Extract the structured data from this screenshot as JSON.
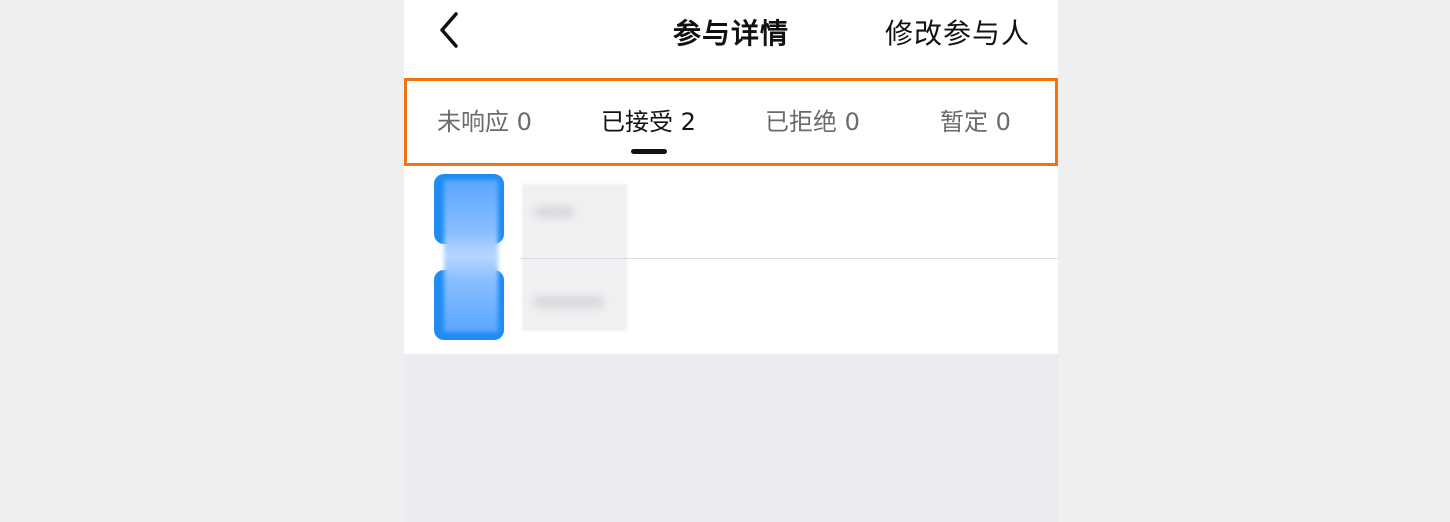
{
  "header": {
    "title": "参与详情",
    "modify_label": "修改参与人"
  },
  "tabs": [
    {
      "label": "未响应 0",
      "active": false
    },
    {
      "label": "已接受 2",
      "active": true
    },
    {
      "label": "已拒绝 0",
      "active": false
    },
    {
      "label": "暂定 0",
      "active": false
    }
  ],
  "icons": {
    "back": "chevron-left-icon"
  },
  "colors": {
    "highlight_border": "#ee7418",
    "avatar": "#1f8cf3",
    "background": "#ececf0"
  }
}
